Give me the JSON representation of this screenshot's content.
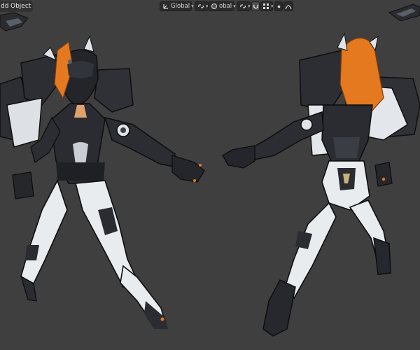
{
  "menu": {
    "add_label": "dd",
    "object_label": "Object"
  },
  "toolbar": {
    "orientation_value": "Global",
    "pivot_value": "obal"
  },
  "icons": {
    "transform_orientation": "axes-icon",
    "link": "link-icon",
    "pivot": "pivot-icon",
    "snap": "magnet-icon",
    "snap_grid": "grid-icon",
    "proportional_edit": "proportional-edit-icon",
    "falloff": "falloff-curve-icon"
  },
  "colors": {
    "viewport_bg": "#3f3f3f",
    "accent_orange": "#e5791f",
    "armor_dark": "#25272a",
    "armor_white": "#e9ecef"
  }
}
